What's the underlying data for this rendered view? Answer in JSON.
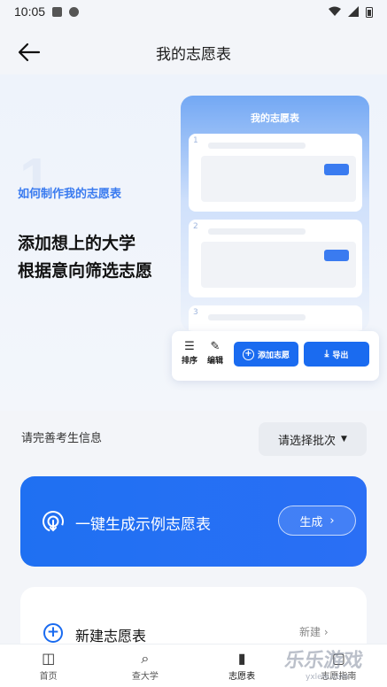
{
  "status_bar": {
    "time": "10:05"
  },
  "header": {
    "title": "我的志愿表"
  },
  "hero": {
    "step_number": "1",
    "how_label": "如何制作我的志愿表",
    "slogan_line1": "添加想上的大学",
    "slogan_line2": "根据意向筛选志愿",
    "mock": {
      "title": "我的志愿表",
      "items": [
        "1",
        "2",
        "3"
      ],
      "toolbar": {
        "sort_label": "排序",
        "edit_label": "编辑",
        "add_label": "添加志愿",
        "export_label": "导出"
      }
    }
  },
  "info": {
    "prompt": "请完善考生信息",
    "batch_select": "请选择批次"
  },
  "generate": {
    "text": "一键生成示例志愿表",
    "button": "生成"
  },
  "new_table": {
    "text": "新建志愿表",
    "right": "新建"
  },
  "tabbar": {
    "items": [
      {
        "label": "首页",
        "icon": "book-open-icon"
      },
      {
        "label": "查大学",
        "icon": "search-icon"
      },
      {
        "label": "志愿表",
        "icon": "notebook-icon"
      },
      {
        "label": "志愿指南",
        "icon": "guide-icon"
      }
    ]
  },
  "watermark": {
    "text": "乐乐游戏",
    "url": "yxlele.com"
  },
  "colors": {
    "accent": "#1a6bf0",
    "background": "#f3f5f9"
  }
}
